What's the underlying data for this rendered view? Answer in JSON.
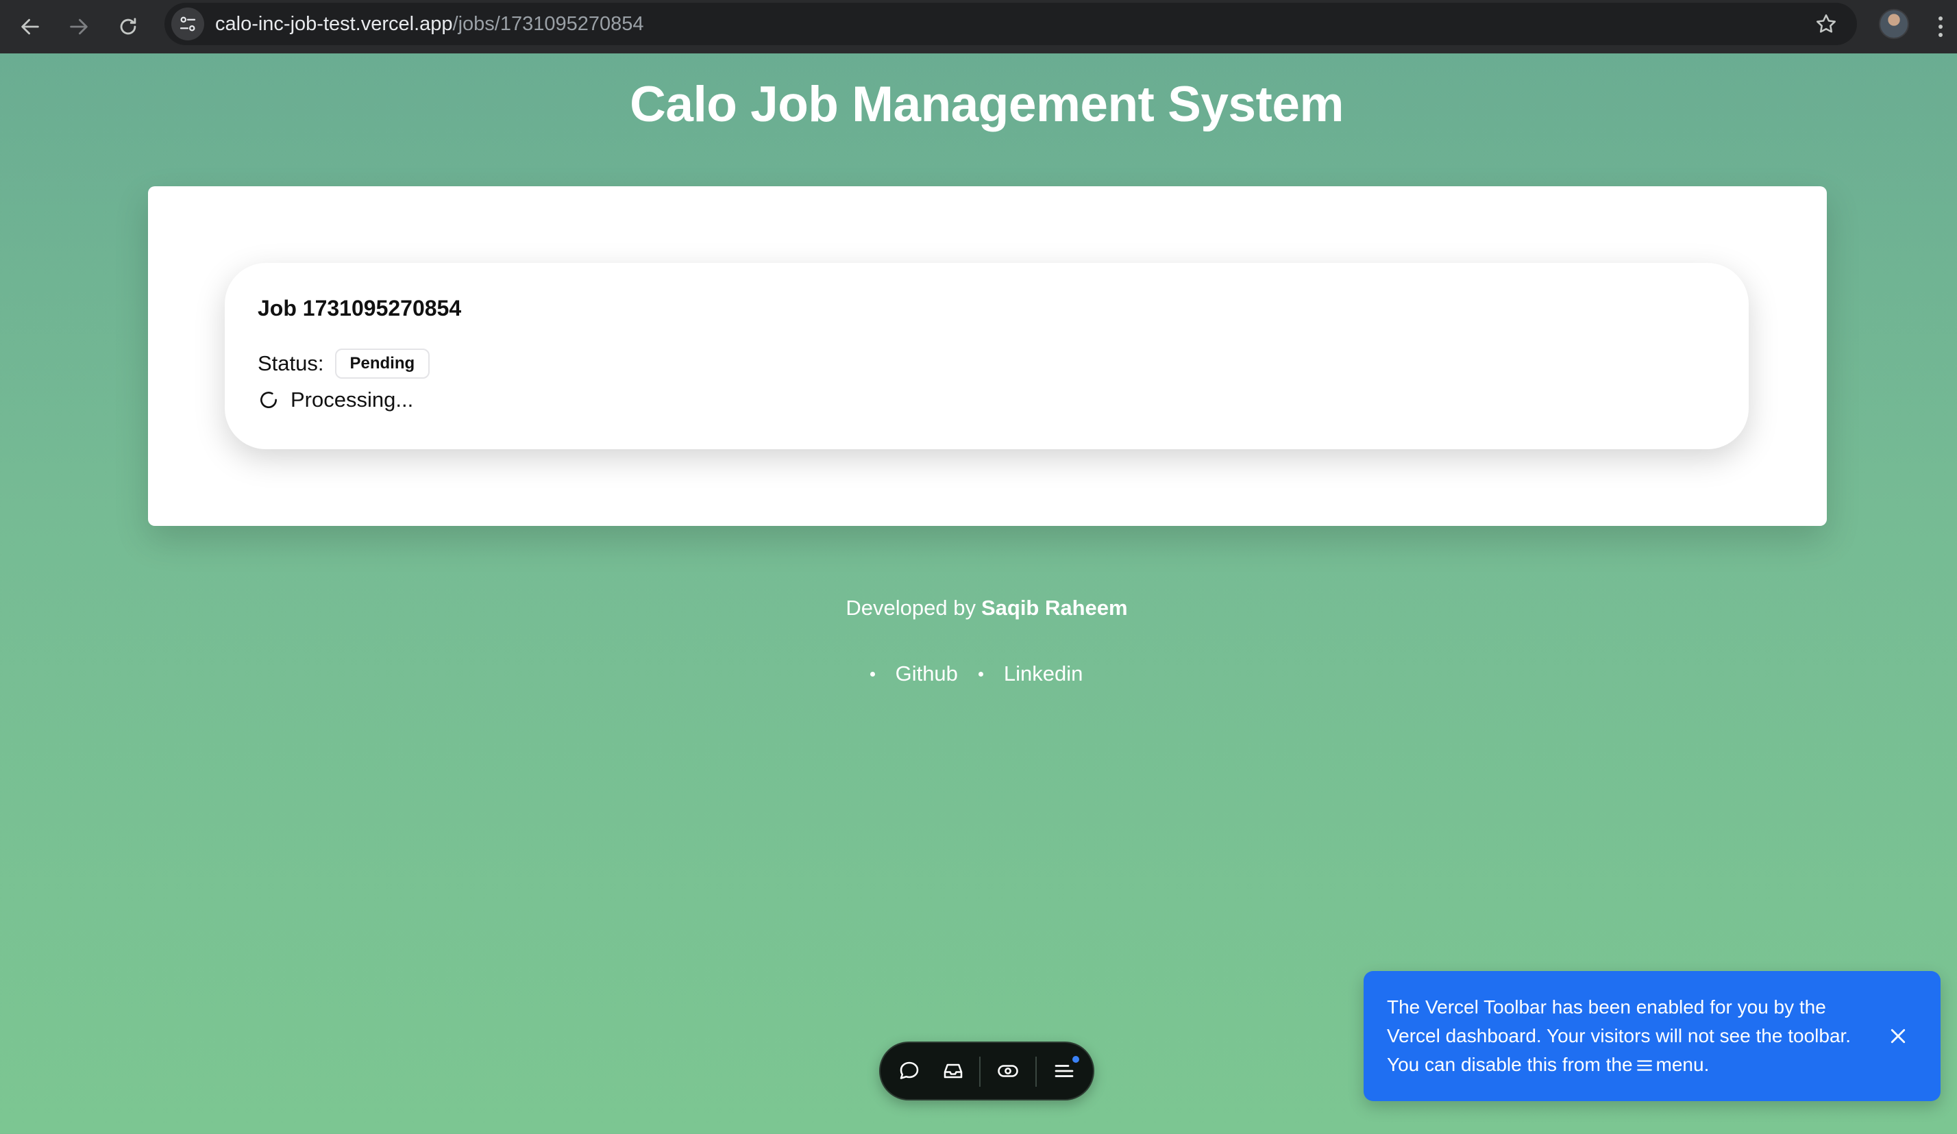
{
  "browser": {
    "url_host": "calo-inc-job-test.vercel.app",
    "url_path": "/jobs/1731095270854"
  },
  "page": {
    "title": "Calo Job Management System"
  },
  "job": {
    "title": "Job 1731095270854",
    "status_label": "Status:",
    "status_value": "Pending",
    "processing_text": "Processing..."
  },
  "footer": {
    "developed_by": "Developed by",
    "author": "Saqib Raheem",
    "links": [
      "Github",
      "Linkedin"
    ]
  },
  "vercel_notice": {
    "text_before_icon": "The Vercel Toolbar has been enabled for you by the Vercel dashboard. Your visitors will not see the toolbar. You can disable this from the",
    "text_after_icon": "menu."
  },
  "icons": {
    "back": "back-arrow-icon",
    "forward": "forward-arrow-icon",
    "reload": "reload-icon",
    "site_info": "tune-icon",
    "bookmark": "star-icon",
    "spinner": "spinner-icon",
    "comment": "comment-icon",
    "inbox": "inbox-icon",
    "preview": "eye-icon",
    "menu": "menu-icon",
    "close": "close-icon"
  },
  "colors": {
    "background_top": "#69ab92",
    "background_bottom": "#7cc692",
    "notice": "#1f6ff2",
    "toolbar": "#0f1512"
  }
}
